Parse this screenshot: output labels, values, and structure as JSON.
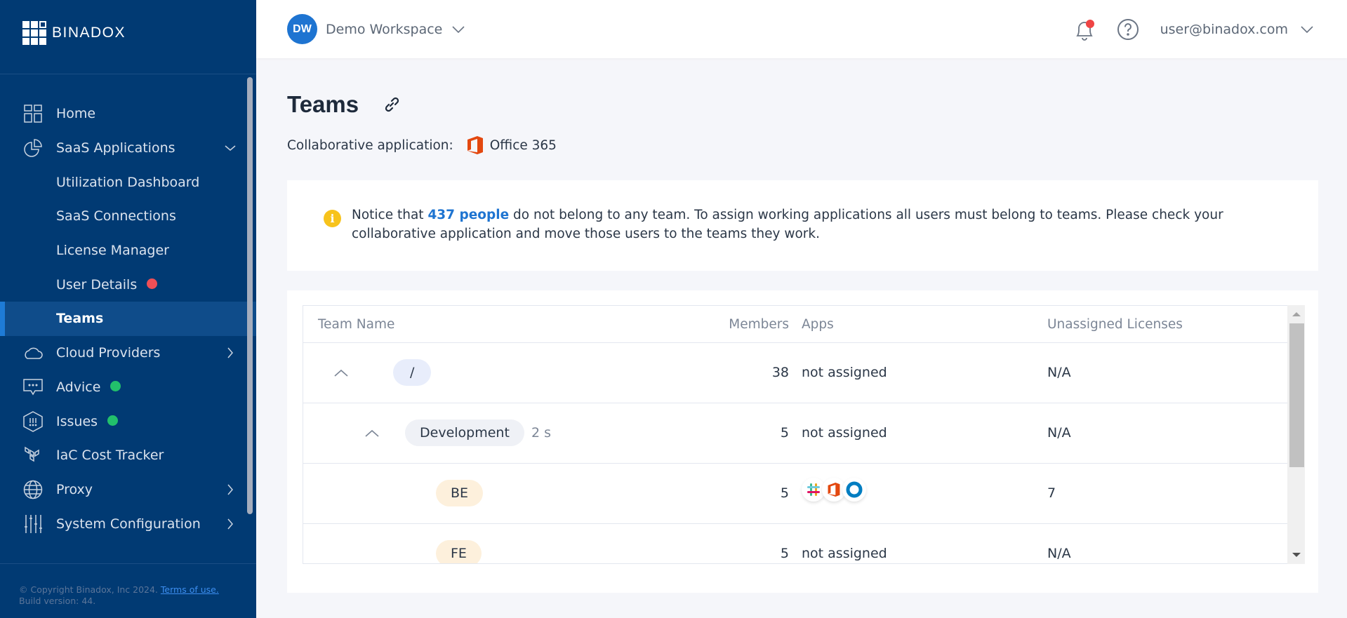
{
  "brand": {
    "name": "BINADOX"
  },
  "sidebar": {
    "items": [
      {
        "label": "Home",
        "icon": "dashboard-grid-icon"
      },
      {
        "label": "SaaS Applications",
        "icon": "pie-chart-icon",
        "expanded": true
      },
      {
        "label": "Utilization Dashboard"
      },
      {
        "label": "SaaS Connections"
      },
      {
        "label": "License Manager"
      },
      {
        "label": "User Details",
        "badge_color": "#f04f56"
      },
      {
        "label": "Teams",
        "active": true
      },
      {
        "label": "Cloud Providers",
        "icon": "cloud-icon"
      },
      {
        "label": "Advice",
        "icon": "chat-bubble-icon",
        "badge_color": "#22c06b"
      },
      {
        "label": "Issues",
        "icon": "hexagon-alert-icon",
        "badge_color": "#22c06b"
      },
      {
        "label": "IaC Cost Tracker",
        "icon": "terraform-icon"
      },
      {
        "label": "Proxy",
        "icon": "globe-icon"
      },
      {
        "label": "System Configuration",
        "icon": "sliders-icon"
      }
    ],
    "footer": {
      "copyright": "© Copyright Binadox, Inc 2024.",
      "terms_link": "Terms of use.",
      "build": "Build version: 44."
    }
  },
  "header": {
    "workspace_initials": "DW",
    "workspace_name": "Demo Workspace",
    "user_email": "user@binadox.com",
    "notification_badge": true
  },
  "page": {
    "title": "Teams",
    "collab_label": "Collaborative application:",
    "collab_app": "Office 365"
  },
  "notice": {
    "prefix": "Notice that ",
    "count_link": "437 people",
    "suffix": " do not belong to any team. To assign working applications all users must belong to teams. Please check your collaborative application and move those users to the teams they work."
  },
  "table": {
    "columns": [
      "Team Name",
      "Members",
      "Apps",
      "Unassigned Licenses"
    ],
    "rows": [
      {
        "name": "/",
        "level": 0,
        "expanded": true,
        "members": "38",
        "apps": "not assigned",
        "licenses": "N/A"
      },
      {
        "name": "Development",
        "level": 1,
        "expanded": true,
        "sub_count": "2 s",
        "members": "5",
        "apps": "not assigned",
        "licenses": "N/A"
      },
      {
        "name": "BE",
        "level": 2,
        "members": "5",
        "apps_icons": [
          "slack-icon",
          "office365-icon",
          "okta-icon"
        ],
        "licenses": "7"
      },
      {
        "name": "FE",
        "level": 2,
        "members": "5",
        "apps": "not assigned",
        "licenses": "N/A"
      }
    ]
  }
}
